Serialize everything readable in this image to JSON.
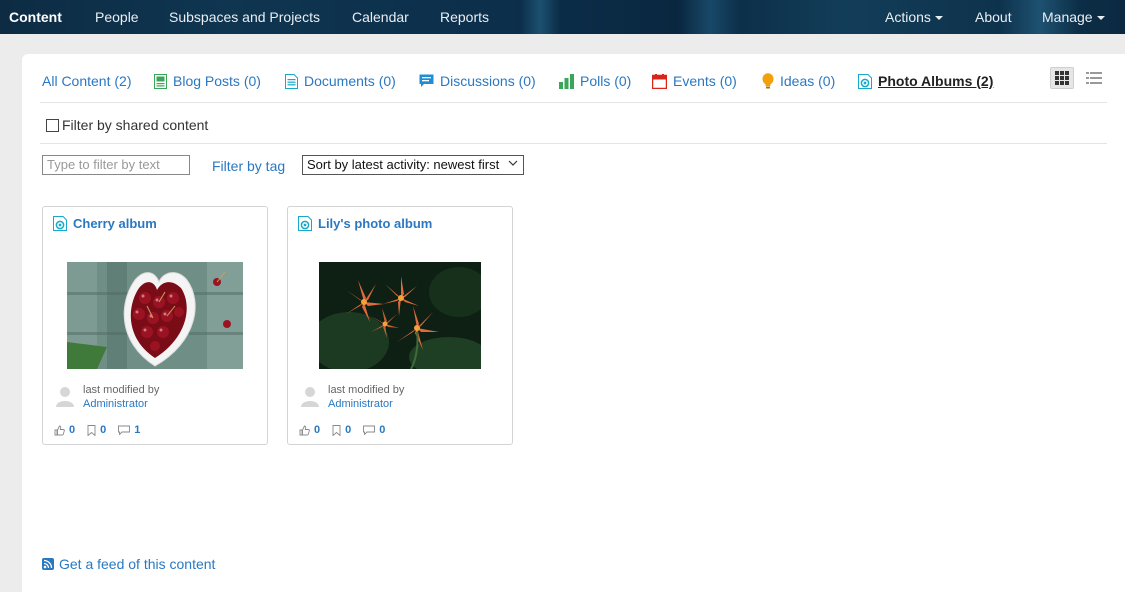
{
  "nav": {
    "items": [
      "Content",
      "People",
      "Subspaces and Projects",
      "Calendar",
      "Reports"
    ],
    "actions": "Actions",
    "about": "About",
    "manage": "Manage"
  },
  "tabs": [
    {
      "label": "All Content (2)",
      "icon": "none"
    },
    {
      "label": "Blog Posts (0)",
      "icon": "blog-icon"
    },
    {
      "label": "Documents (0)",
      "icon": "document-icon"
    },
    {
      "label": "Discussions (0)",
      "icon": "discussion-icon"
    },
    {
      "label": "Polls (0)",
      "icon": "poll-icon"
    },
    {
      "label": "Events (0)",
      "icon": "event-icon"
    },
    {
      "label": "Ideas (0)",
      "icon": "idea-icon"
    },
    {
      "label": "Photo Albums (2)",
      "icon": "photo-album-icon"
    }
  ],
  "filters": {
    "shared_label": "Filter by shared content",
    "text_placeholder": "Type to filter by text",
    "tag_label": "Filter by tag",
    "sort_value": "Sort by latest activity: newest first"
  },
  "cards": [
    {
      "title": "Cherry album",
      "modified_label": "last modified by",
      "user": "Administrator",
      "likes": "0",
      "bookmarks": "0",
      "comments": "1"
    },
    {
      "title": "Lily's photo album",
      "modified_label": "last modified by",
      "user": "Administrator",
      "likes": "0",
      "bookmarks": "0",
      "comments": "0"
    }
  ],
  "feed_label": "Get a feed of this content",
  "colors": {
    "link": "#2a78c2",
    "nav_bg": "#0f3550",
    "blog": "#3aa65a",
    "discussion": "#1e8fd6",
    "poll": "#3aa65a",
    "event": "#d9261c",
    "idea": "#f2a10c",
    "album": "#17a9c9"
  }
}
